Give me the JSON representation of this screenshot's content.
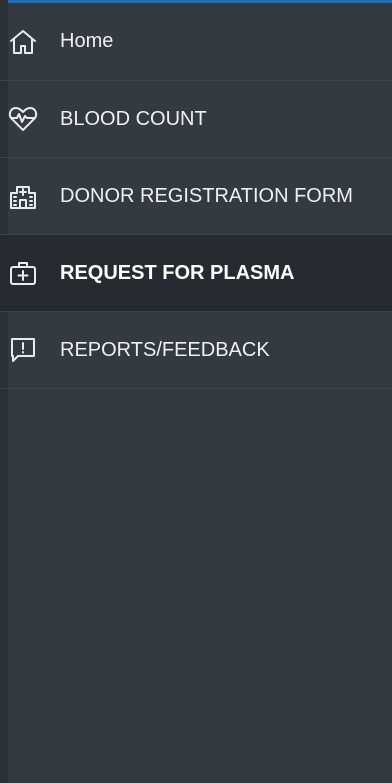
{
  "accent_color": "#1c6fb8",
  "menu": {
    "items": [
      {
        "label": "Home",
        "icon": "home-icon",
        "active": false
      },
      {
        "label": "BLOOD COUNT",
        "icon": "heartbeat-icon",
        "active": false
      },
      {
        "label": "DONOR REGISTRATION FORM",
        "icon": "hospital-icon",
        "active": false
      },
      {
        "label": "REQUEST FOR PLASMA",
        "icon": "medkit-icon",
        "active": true
      },
      {
        "label": "REPORTS/FEEDBACK",
        "icon": "feedback-icon",
        "active": false
      }
    ]
  }
}
